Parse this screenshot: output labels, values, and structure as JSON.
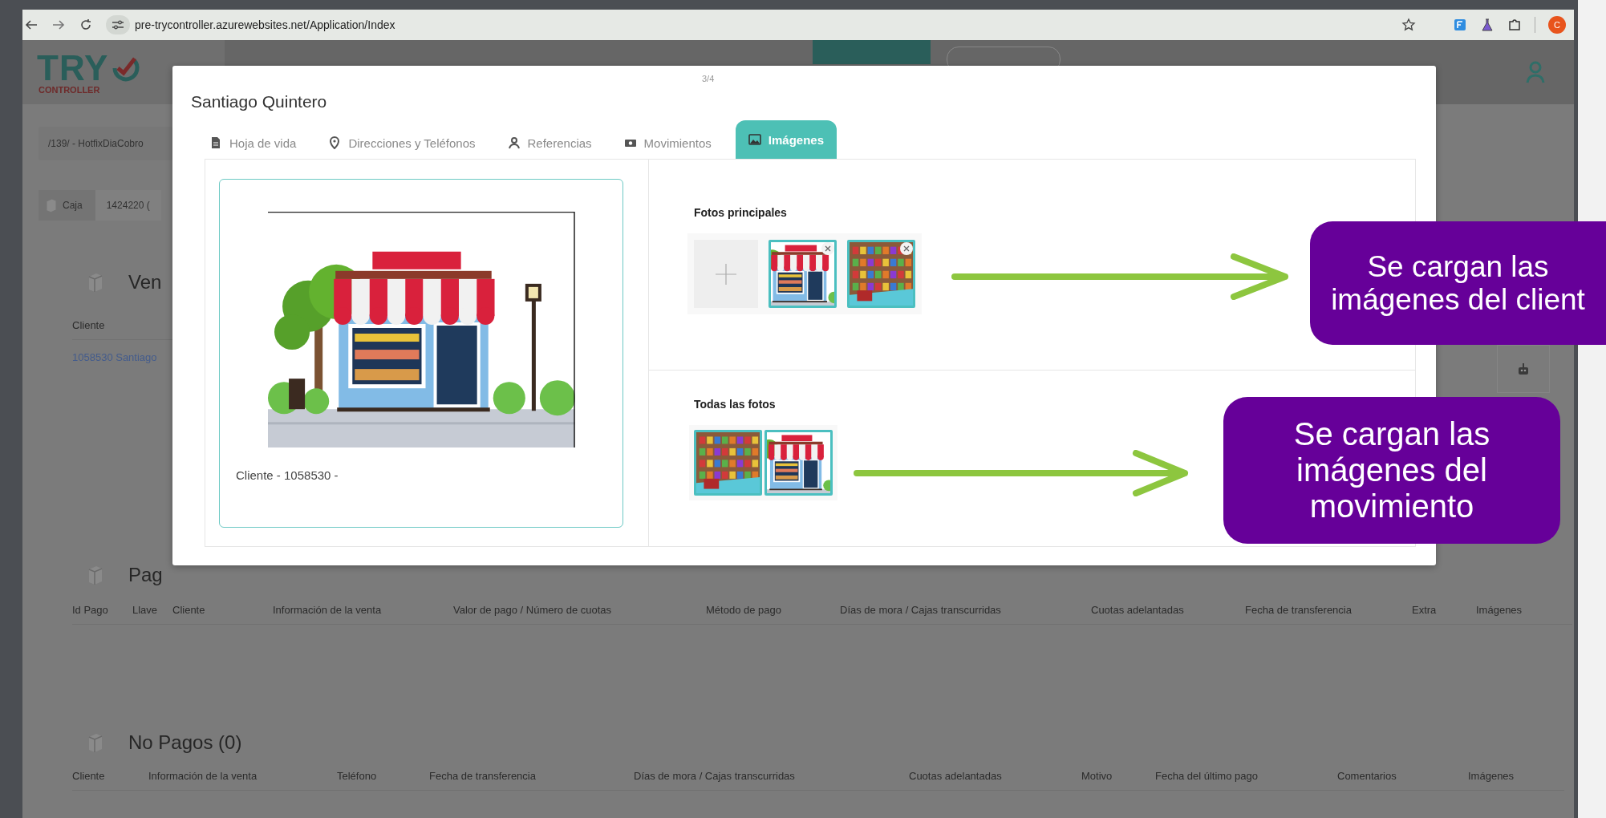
{
  "browser": {
    "url": "pre-trycontroller.azurewebsites.net/Application/Index",
    "profile_initial": "C"
  },
  "app": {
    "logo": {
      "wordmark": "TRY",
      "subtitle": "CONTROLLER"
    },
    "breadcrumb": "/139/ - HotfixDiaCobro",
    "box": {
      "label": "Caja",
      "value": "1424220 ("
    },
    "sales": {
      "title": "Ven",
      "columns": [
        "Cliente"
      ],
      "rows": [
        [
          "1058530 Santiago"
        ]
      ]
    },
    "payments": {
      "title": "Pag",
      "columns": [
        "Id Pago",
        "Llave",
        "Cliente",
        "Información de la venta",
        "Valor de pago / Número de cuotas",
        "Método de pago",
        "Días de mora / Cajas transcurridas",
        "Cuotas adelantadas",
        "Fecha de transferencia",
        "Extra",
        "Imágenes"
      ]
    },
    "non_payments": {
      "title": "No Pagos (0)",
      "columns": [
        "Cliente",
        "Información de la venta",
        "Teléfono",
        "Fecha de transferencia",
        "Días de mora / Cajas transcurridas",
        "Cuotas adelantadas",
        "Motivo",
        "Fecha del último pago",
        "Comentarios",
        "Imágenes"
      ]
    }
  },
  "modal": {
    "counter": "3/4",
    "title": "Santiago Quintero",
    "tabs": [
      {
        "label": "Hoja de vida",
        "selected": false
      },
      {
        "label": "Direcciones y Teléfonos",
        "selected": false
      },
      {
        "label": "Referencias",
        "selected": false
      },
      {
        "label": "Movimientos",
        "selected": false
      },
      {
        "label": "Imágenes",
        "selected": true
      }
    ],
    "main_image": {
      "kind": "storefront",
      "caption": "Cliente - 1058530 -"
    },
    "main_photos": {
      "title": "Fotos principales",
      "photos": [
        {
          "kind": "storefront",
          "removable": true
        },
        {
          "kind": "shelves",
          "removable": true
        }
      ]
    },
    "all_photos": {
      "title": "Todas las fotos",
      "photos": [
        {
          "kind": "shelves",
          "removable": false
        },
        {
          "kind": "storefront",
          "removable": false
        }
      ]
    }
  },
  "callouts": [
    {
      "text": "Se cargan las\nimágenes del client"
    },
    {
      "text": "Se cargan las\nimágenes del\nmovimiento"
    }
  ]
}
